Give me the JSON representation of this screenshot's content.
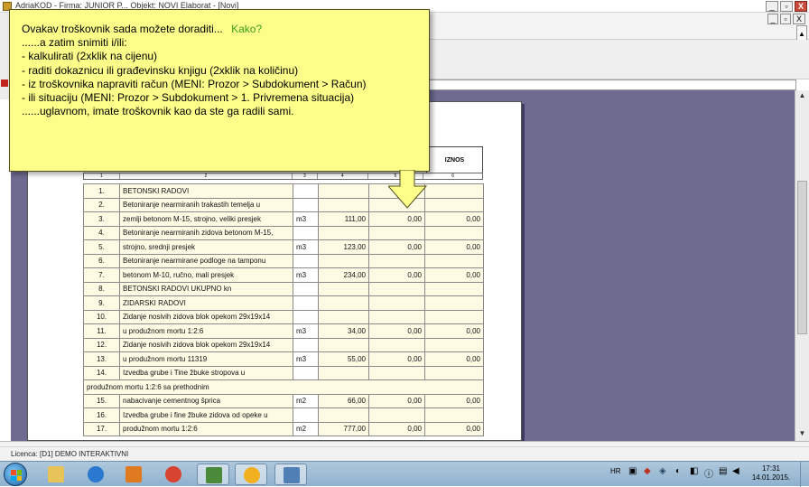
{
  "window": {
    "title": "AdriaKOD - Firma: JUNIOR P... Objekt: NOVI  Elaborat - [Novi]",
    "minimize_glyph": "_",
    "restore_glyph": "▫",
    "close_glyph": "X",
    "inner_scroll_up": "▲"
  },
  "tooltip": {
    "heading": "Ovakav troškovnik sada možete doraditi...",
    "link": "Kako?",
    "lines": [
      "......a zatim snimiti i/ili:",
      "- kalkulirati (2xklik na cijenu)",
      "- raditi dokaznicu ili građevinsku knjigu (2xklik na količinu)",
      "- iz troškovnika napraviti račun (MENI: Prozor > Subdokument > Račun)",
      "- ili situaciju (MENI: Prozor > Subdokument > 1. Privremena situacija)",
      "......uglavnom, imate troškovnik kao da ste ga radili sami."
    ],
    "bg_color": "#fdfe89",
    "link_color": "#3aa01e"
  },
  "table": {
    "header_amount": "IZNOS",
    "column_numbers": [
      "1",
      "2",
      "3",
      "4",
      "5",
      "6"
    ],
    "rows": [
      {
        "num": "1.",
        "desc": "BETONSKI RADOVI",
        "unit": "",
        "qty": "",
        "price": "",
        "total": ""
      },
      {
        "num": "2.",
        "desc": "Betoniranje nearmiranih trakastih temelja u",
        "unit": "",
        "qty": "",
        "price": "",
        "total": ""
      },
      {
        "num": "3.",
        "desc": "zemlji betonom M-15, strojno, veliki presjek",
        "unit": "m3",
        "qty": "111,00",
        "price": "0,00",
        "total": "0,00"
      },
      {
        "num": "4.",
        "desc": "Betoniranje nearmiranih zidova betonom M-15,",
        "unit": "",
        "qty": "",
        "price": "",
        "total": ""
      },
      {
        "num": "5.",
        "desc": "strojno, srednji presjek",
        "unit": "m3",
        "qty": "123,00",
        "price": "0,00",
        "total": "0,00"
      },
      {
        "num": "6.",
        "desc": "Betoniranje nearmirane podloge na tamponu",
        "unit": "",
        "qty": "",
        "price": "",
        "total": ""
      },
      {
        "num": "7.",
        "desc": "betonom M-10, ručno, mali presjek",
        "unit": "m3",
        "qty": "234,00",
        "price": "0,00",
        "total": "0,00"
      },
      {
        "num": "8.",
        "desc": "BETONSKI RADOVI UKUPNO kn",
        "unit": "",
        "qty": "",
        "price": "",
        "total": ""
      },
      {
        "num": "9.",
        "desc": "ZIDARSKI RADOVI",
        "unit": "",
        "qty": "",
        "price": "",
        "total": ""
      },
      {
        "num": "10.",
        "desc": "Zidanje nosivih zidova blok opekom 29x19x14",
        "unit": "",
        "qty": "",
        "price": "",
        "total": ""
      },
      {
        "num": "11.",
        "desc": "u produžnom mortu 1:2:6",
        "unit": "m3",
        "qty": "34,00",
        "price": "0,00",
        "total": "0,00"
      },
      {
        "num": "12.",
        "desc": "Zidanje nosivih zidova blok opekom 29x19x14",
        "unit": "",
        "qty": "",
        "price": "",
        "total": ""
      },
      {
        "num": "13.",
        "desc": "u produžnom mortu 11319",
        "unit": "m3",
        "qty": "55,00",
        "price": "0,00",
        "total": "0,00"
      },
      {
        "num": "14.",
        "desc": "Izvedba grube i   Tine žbuke stropova u",
        "unit": "",
        "qty": "",
        "price": "",
        "total": ""
      },
      {
        "continuation": "produžnom mortu 1:2:6 sa prethodnim"
      },
      {
        "num": "15.",
        "desc": "nabacivanje cementnog šprica",
        "unit": "m2",
        "qty": "66,00",
        "price": "0,00",
        "total": "0,00"
      },
      {
        "num": "16.",
        "desc": "Izvedba grube i  fine žbuke zidova od opeke u",
        "unit": "",
        "qty": "",
        "price": "",
        "total": ""
      },
      {
        "num": "17.",
        "desc": "produžnom mortu 1:2:6",
        "unit": "m2",
        "qty": "777,00",
        "price": "0,00",
        "total": "0,00"
      }
    ]
  },
  "statusbar": {
    "text": "Licenca: [D1] DEMO INTERAKTIVNI"
  },
  "taskbar": {
    "apps": [
      {
        "name": "windows-explorer-icon",
        "color": "#e8c35a"
      },
      {
        "name": "internet-explorer-icon",
        "color": "#2a78d0"
      },
      {
        "name": "media-player-icon",
        "color": "#e07a20"
      },
      {
        "name": "chrome-icon",
        "color": "#d8432f"
      },
      {
        "name": "adriakod-icon",
        "color": "#4a8a3a"
      },
      {
        "name": "sun-app-icon",
        "color": "#f0b020"
      },
      {
        "name": "network-app-icon",
        "color": "#4f7fb5"
      }
    ],
    "language": "HR",
    "time": "17:31",
    "date": "14.01.2015."
  }
}
